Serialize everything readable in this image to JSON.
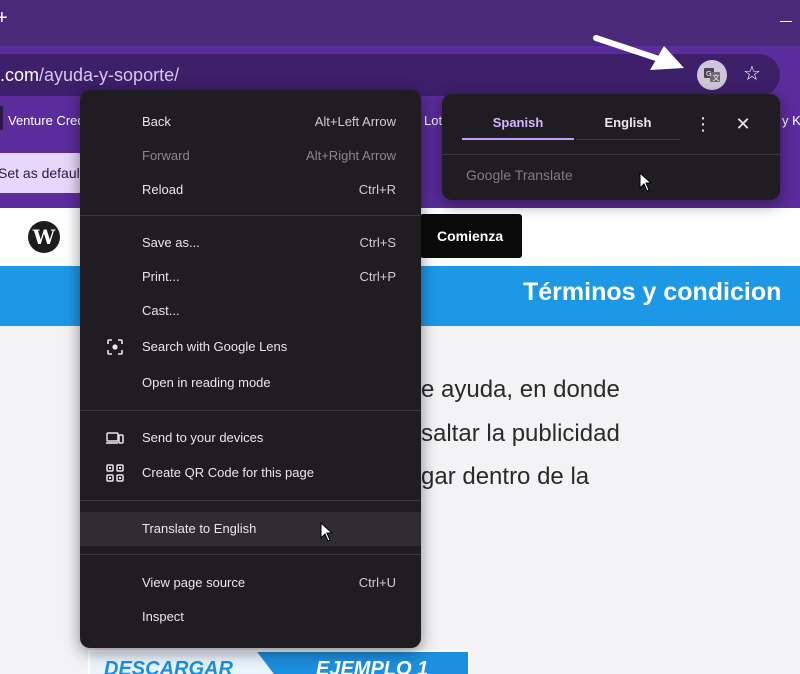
{
  "browser": {
    "address_bar": {
      "domain": ".com",
      "path": "/ayuda-y-soporte/"
    },
    "bookmarks": [
      "Venture Credi",
      "Lot",
      "y K"
    ],
    "infobar": {
      "set_default_label": "Set as default"
    }
  },
  "page": {
    "header_button": "Comienza",
    "banner_title": "Términos y condicion",
    "body_lines": [
      "e ayuda, en donde",
      "saltar la publicidad",
      "gar dentro de la"
    ],
    "download_banner": {
      "left": "DESCARGAR",
      "right": "EJEMPLO 1"
    }
  },
  "context_menu": {
    "groups": [
      [
        {
          "label": "Back",
          "shortcut": "Alt+Left Arrow"
        },
        {
          "label": "Forward",
          "shortcut": "Alt+Right Arrow",
          "disabled": true
        },
        {
          "label": "Reload",
          "shortcut": "Ctrl+R"
        }
      ],
      [
        {
          "label": "Save as...",
          "shortcut": "Ctrl+S"
        },
        {
          "label": "Print...",
          "shortcut": "Ctrl+P"
        },
        {
          "label": "Cast..."
        },
        {
          "label": "Search with Google Lens",
          "icon": "google-lens-icon"
        },
        {
          "label": "Open in reading mode"
        }
      ],
      [
        {
          "label": "Send to your devices",
          "icon": "devices-icon"
        },
        {
          "label": "Create QR Code for this page",
          "icon": "qr-code-icon"
        }
      ],
      [
        {
          "label": "Translate to English",
          "highlighted": true
        }
      ],
      [
        {
          "label": "View page source",
          "shortcut": "Ctrl+U"
        },
        {
          "label": "Inspect"
        }
      ]
    ]
  },
  "translate_bubble": {
    "source_language": "Spanish",
    "target_language": "English",
    "provider": "Google Translate",
    "active_tab": "Spanish"
  },
  "colors": {
    "chrome_purple": "#5b2c9c",
    "tabstrip_purple": "#4a2a78",
    "menu_bg": "#1f1d22",
    "accent_lilac": "#c39cff",
    "banner_blue": "#1d98e6"
  }
}
